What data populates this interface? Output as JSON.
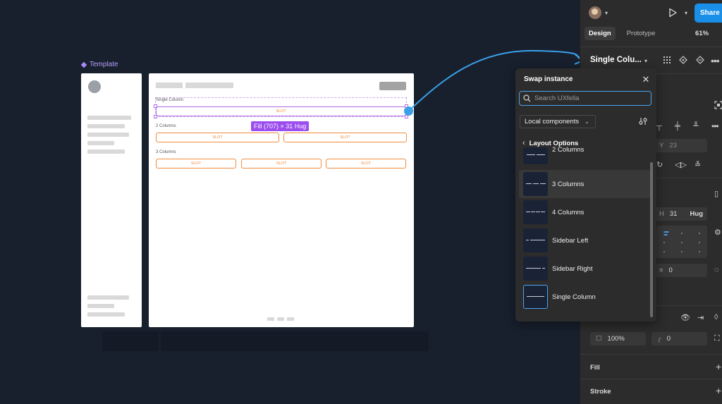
{
  "canvas": {
    "frame_label": "Template",
    "sections": {
      "single": "Single Column",
      "two": "2 Columns",
      "three": "3 Columns"
    },
    "slot_label": "SLOT",
    "size_badge": "Fill (707) × 31 Hug"
  },
  "swap": {
    "title": "Swap instance",
    "search_placeholder": "Search UXfella",
    "library": "Local components",
    "section": "Layout Options",
    "items": [
      {
        "name": "2 Columns"
      },
      {
        "name": "3 Columns"
      },
      {
        "name": "4 Columns"
      },
      {
        "name": "Sidebar Left"
      },
      {
        "name": "Sidebar Right"
      },
      {
        "name": "Single Column"
      }
    ]
  },
  "panel": {
    "share": "Share",
    "tabs": [
      "Design",
      "Prototype"
    ],
    "zoom": "61%",
    "instance_name": "Single Colu...",
    "y_label": "Y",
    "y_value": "23",
    "h_label": "H",
    "h_value": "31",
    "h_mode": "Hug",
    "gap_value": "0",
    "opacity": "100%",
    "radius": "0",
    "fill": "Fill",
    "stroke": "Stroke"
  },
  "colors": {
    "accent": "#1a8fe8",
    "selection": "#9b4df0",
    "slot": "#f08a3c"
  }
}
